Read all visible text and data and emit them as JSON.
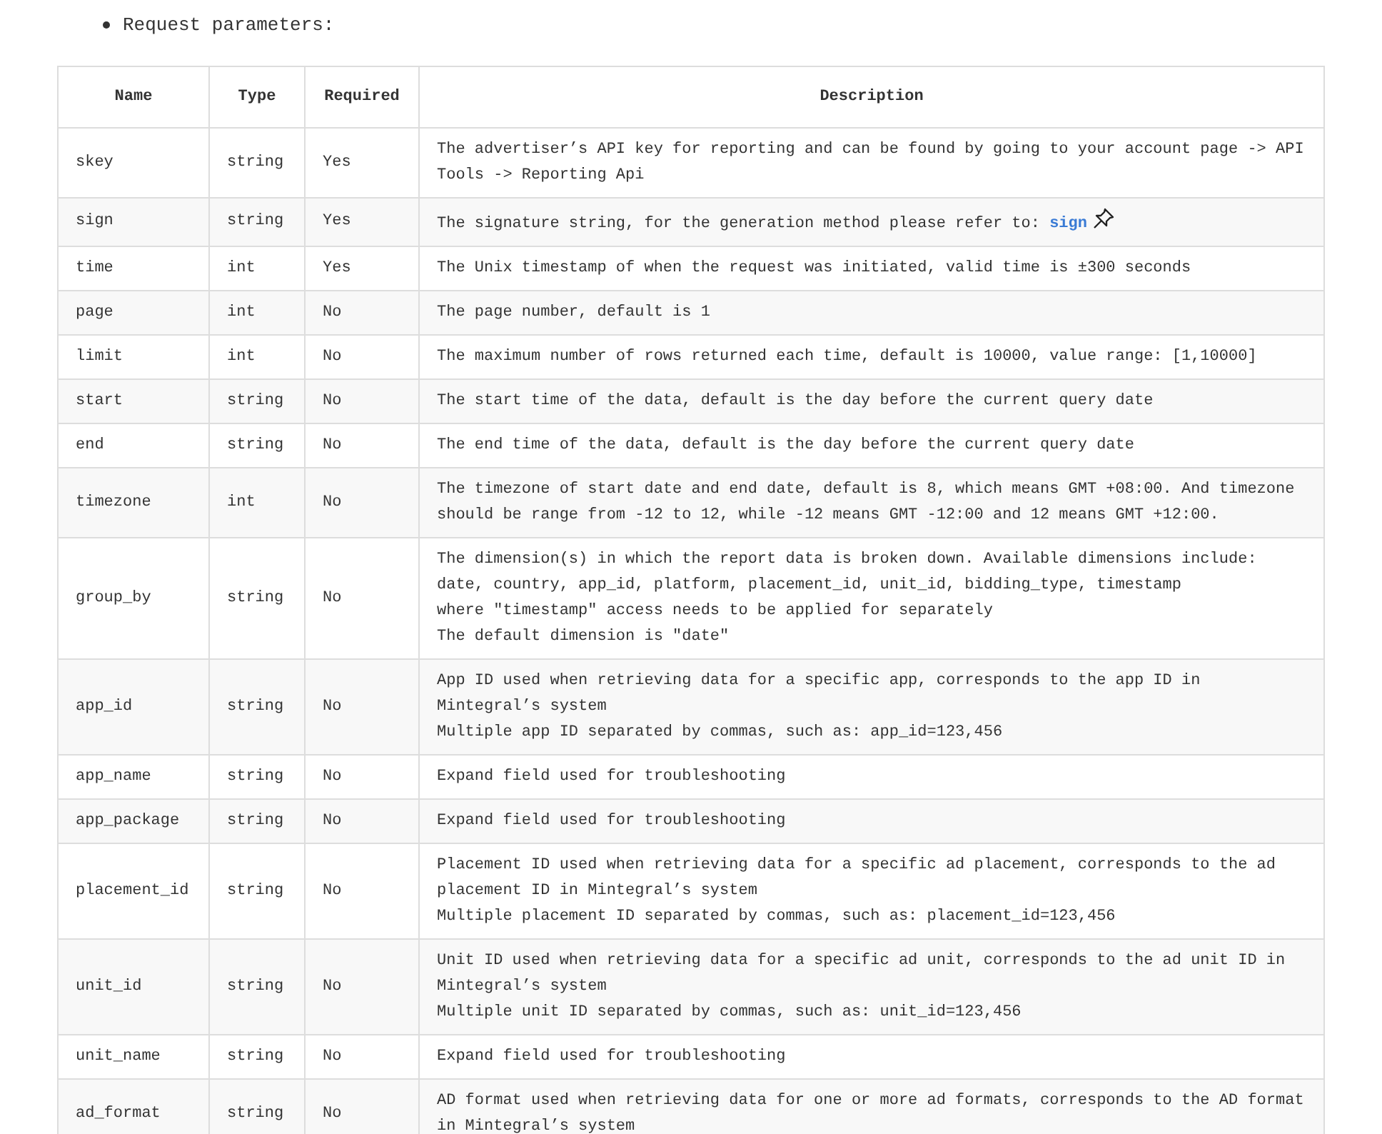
{
  "intro": {
    "text": "Request parameters:"
  },
  "table": {
    "columns": [
      "Name",
      "Type",
      "Required",
      "Description"
    ],
    "rows": [
      {
        "name": "skey",
        "type": "string",
        "required": "Yes",
        "description": "The advertiser’s API key for reporting and can be found by going to your account page -> API Tools -> Reporting Api"
      },
      {
        "name": "sign",
        "type": "string",
        "required": "Yes",
        "description": "The signature string, for the generation method please refer to: ",
        "link": "sign",
        "pin": true
      },
      {
        "name": "time",
        "type": "int",
        "required": "Yes",
        "description": "The Unix timestamp of when the request was initiated, valid time is ±300 seconds"
      },
      {
        "name": "page",
        "type": "int",
        "required": "No",
        "description": "The page number, default is 1"
      },
      {
        "name": "limit",
        "type": "int",
        "required": "No",
        "description": "The maximum number of rows returned each time, default is 10000, value range: [1,10000]"
      },
      {
        "name": "start",
        "type": "string",
        "required": "No",
        "description": "The start time of the data, default is the day before the current query date"
      },
      {
        "name": "end",
        "type": "string",
        "required": "No",
        "description": "The end time of the data, default is the day before the current query date"
      },
      {
        "name": "timezone",
        "type": "int",
        "required": "No",
        "description": "The timezone of start date and end date, default is 8, which means GMT +08:00. And timezone should be range from -12 to 12, while -12 means GMT -12:00 and 12 means GMT +12:00."
      },
      {
        "name": "group_by",
        "type": "string",
        "required": "No",
        "description": "The dimension(s) in which the report data is broken down. Available dimensions include:\ndate, country, app_id, platform, placement_id, unit_id, bidding_type, timestamp\nwhere \"timestamp\" access needs to be applied for separately\nThe default dimension is \"date\""
      },
      {
        "name": "app_id",
        "type": "string",
        "required": "No",
        "description": "App ID used when retrieving data for a specific app, corresponds to the app ID in Mintegral’s system\nMultiple app ID separated by commas, such as: app_id=123,456"
      },
      {
        "name": "app_name",
        "type": "string",
        "required": "No",
        "description": "Expand field used for troubleshooting"
      },
      {
        "name": "app_package",
        "type": "string",
        "required": "No",
        "description": "Expand field used for troubleshooting"
      },
      {
        "name": "placement_id",
        "type": "string",
        "required": "No",
        "description": "Placement ID used when retrieving data for a specific ad placement, corresponds to the ad placement ID in Mintegral’s system\nMultiple placement ID separated by commas, such as: placement_id=123,456"
      },
      {
        "name": "unit_id",
        "type": "string",
        "required": "No",
        "description": "Unit ID used when retrieving data for a specific ad unit, corresponds to the ad unit ID in Mintegral’s system\nMultiple unit ID separated by commas, such as: unit_id=123,456"
      },
      {
        "name": "unit_name",
        "type": "string",
        "required": "No",
        "description": "Expand field used for troubleshooting"
      },
      {
        "name": "ad_format",
        "type": "string",
        "required": "No",
        "description": "AD format used when retrieving data for one or more ad formats, corresponds to the AD format in Mintegral’s system"
      }
    ]
  }
}
